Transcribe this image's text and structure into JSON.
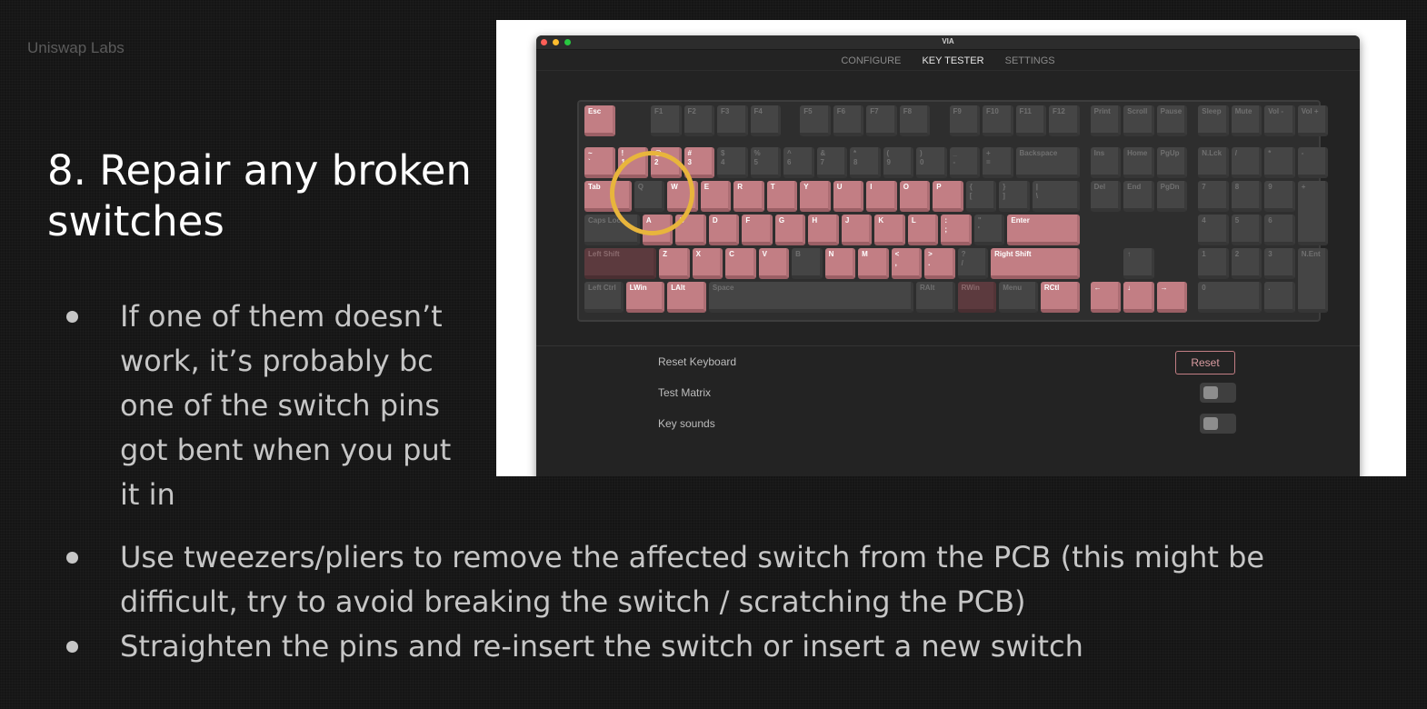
{
  "brand": "Uniswap Labs",
  "slide_title": "8. Repair any broken switches",
  "bullets": [
    "If one of them doesn’t work, it’s probably bc one of the switch pins got bent when you put it in",
    "Use tweezers/pliers to remove the affected switch from the PCB (this might be difficult, try to avoid breaking the switch / scratching the PCB)",
    "Straighten the pins and re-insert the switch or insert a new switch"
  ],
  "screenshot": {
    "window_title": "VIA",
    "tabs": [
      "CONFIGURE",
      "KEY TESTER",
      "SETTINGS"
    ],
    "active_tab": "KEY TESTER",
    "colors": {
      "pressed": "#c27e84",
      "unpressed": "#454545",
      "highlight_ring": "#e8b53c",
      "window_bg": "#232323"
    },
    "keys": [
      {
        "label": "Esc",
        "state": "on"
      },
      {
        "label": "F1",
        "state": "off"
      },
      {
        "label": "F2",
        "state": "off"
      },
      {
        "label": "F3",
        "state": "off"
      },
      {
        "label": "F4",
        "state": "off"
      },
      {
        "label": "F5",
        "state": "off"
      },
      {
        "label": "F6",
        "state": "off"
      },
      {
        "label": "F7",
        "state": "off"
      },
      {
        "label": "F8",
        "state": "off"
      },
      {
        "label": "F9",
        "state": "off"
      },
      {
        "label": "F10",
        "state": "off"
      },
      {
        "label": "F11",
        "state": "off"
      },
      {
        "label": "F12",
        "state": "off"
      },
      {
        "label": "Print",
        "state": "off"
      },
      {
        "label": "Scroll",
        "state": "off"
      },
      {
        "label": "Pause",
        "state": "off"
      },
      {
        "label": "Sleep",
        "state": "off"
      },
      {
        "label": "Mute",
        "state": "off"
      },
      {
        "label": "Vol -",
        "state": "off"
      },
      {
        "label": "Vol +",
        "state": "off"
      },
      {
        "label": "~\n`",
        "state": "on"
      },
      {
        "label": "!\n1",
        "state": "on"
      },
      {
        "label": "@\n2",
        "state": "on"
      },
      {
        "label": "#\n3",
        "state": "on"
      },
      {
        "label": "$\n4",
        "state": "off"
      },
      {
        "label": "%\n5",
        "state": "off"
      },
      {
        "label": "^\n6",
        "state": "off"
      },
      {
        "label": "&\n7",
        "state": "off"
      },
      {
        "label": "*\n8",
        "state": "off"
      },
      {
        "label": "(\n9",
        "state": "off"
      },
      {
        "label": ")\n0",
        "state": "off"
      },
      {
        "label": "_\n-",
        "state": "off"
      },
      {
        "label": "+\n=",
        "state": "off"
      },
      {
        "label": "Backspace",
        "state": "off"
      },
      {
        "label": "Ins",
        "state": "off"
      },
      {
        "label": "Home",
        "state": "off"
      },
      {
        "label": "PgUp",
        "state": "off"
      },
      {
        "label": "N.Lck",
        "state": "off"
      },
      {
        "label": "/",
        "state": "off"
      },
      {
        "label": "*",
        "state": "off"
      },
      {
        "label": "-",
        "state": "off"
      },
      {
        "label": "Tab",
        "state": "on"
      },
      {
        "label": "Q",
        "state": "off"
      },
      {
        "label": "W",
        "state": "on"
      },
      {
        "label": "E",
        "state": "on"
      },
      {
        "label": "R",
        "state": "on"
      },
      {
        "label": "T",
        "state": "on"
      },
      {
        "label": "Y",
        "state": "on"
      },
      {
        "label": "U",
        "state": "on"
      },
      {
        "label": "I",
        "state": "on"
      },
      {
        "label": "O",
        "state": "on"
      },
      {
        "label": "P",
        "state": "on"
      },
      {
        "label": "{\n[",
        "state": "off"
      },
      {
        "label": "}\n]",
        "state": "off"
      },
      {
        "label": "|\n\\",
        "state": "off"
      },
      {
        "label": "Del",
        "state": "off"
      },
      {
        "label": "End",
        "state": "off"
      },
      {
        "label": "PgDn",
        "state": "off"
      },
      {
        "label": "7",
        "state": "off"
      },
      {
        "label": "8",
        "state": "off"
      },
      {
        "label": "9",
        "state": "off"
      },
      {
        "label": "+",
        "state": "off"
      },
      {
        "label": "Caps Lock",
        "state": "off"
      },
      {
        "label": "A",
        "state": "on"
      },
      {
        "label": "S",
        "state": "on"
      },
      {
        "label": "D",
        "state": "on"
      },
      {
        "label": "F",
        "state": "on"
      },
      {
        "label": "G",
        "state": "on"
      },
      {
        "label": "H",
        "state": "on"
      },
      {
        "label": "J",
        "state": "on"
      },
      {
        "label": "K",
        "state": "on"
      },
      {
        "label": "L",
        "state": "on"
      },
      {
        "label": ":\n;",
        "state": "on"
      },
      {
        "label": "\"\n'",
        "state": "off"
      },
      {
        "label": "Enter",
        "state": "on"
      },
      {
        "label": "4",
        "state": "off"
      },
      {
        "label": "5",
        "state": "off"
      },
      {
        "label": "6",
        "state": "off"
      },
      {
        "label": "Left Shift",
        "state": "dim"
      },
      {
        "label": "Z",
        "state": "on"
      },
      {
        "label": "X",
        "state": "on"
      },
      {
        "label": "C",
        "state": "on"
      },
      {
        "label": "V",
        "state": "on"
      },
      {
        "label": "B",
        "state": "off"
      },
      {
        "label": "N",
        "state": "on"
      },
      {
        "label": "M",
        "state": "on"
      },
      {
        "label": "<\n,",
        "state": "on"
      },
      {
        "label": ">\n.",
        "state": "on"
      },
      {
        "label": "?\n/",
        "state": "off"
      },
      {
        "label": "Right Shift",
        "state": "on"
      },
      {
        "label": "↑",
        "state": "off"
      },
      {
        "label": "1",
        "state": "off"
      },
      {
        "label": "2",
        "state": "off"
      },
      {
        "label": "3",
        "state": "off"
      },
      {
        "label": "N.Ent",
        "state": "off"
      },
      {
        "label": "Left Ctrl",
        "state": "off"
      },
      {
        "label": "LWin",
        "state": "on"
      },
      {
        "label": "LAlt",
        "state": "on"
      },
      {
        "label": "Space",
        "state": "off"
      },
      {
        "label": "RAlt",
        "state": "off"
      },
      {
        "label": "RWin",
        "state": "dim"
      },
      {
        "label": "Menu",
        "state": "off"
      },
      {
        "label": "RCtl",
        "state": "on"
      },
      {
        "label": "←",
        "state": "on"
      },
      {
        "label": "↓",
        "state": "on"
      },
      {
        "label": "→",
        "state": "on"
      },
      {
        "label": "0",
        "state": "off"
      },
      {
        "label": ".",
        "state": "off"
      }
    ],
    "settings": {
      "reset_keyboard_label": "Reset Keyboard",
      "reset_button": "Reset",
      "test_matrix_label": "Test Matrix",
      "test_matrix_on": false,
      "key_sounds_label": "Key sounds",
      "key_sounds_on": false
    }
  }
}
